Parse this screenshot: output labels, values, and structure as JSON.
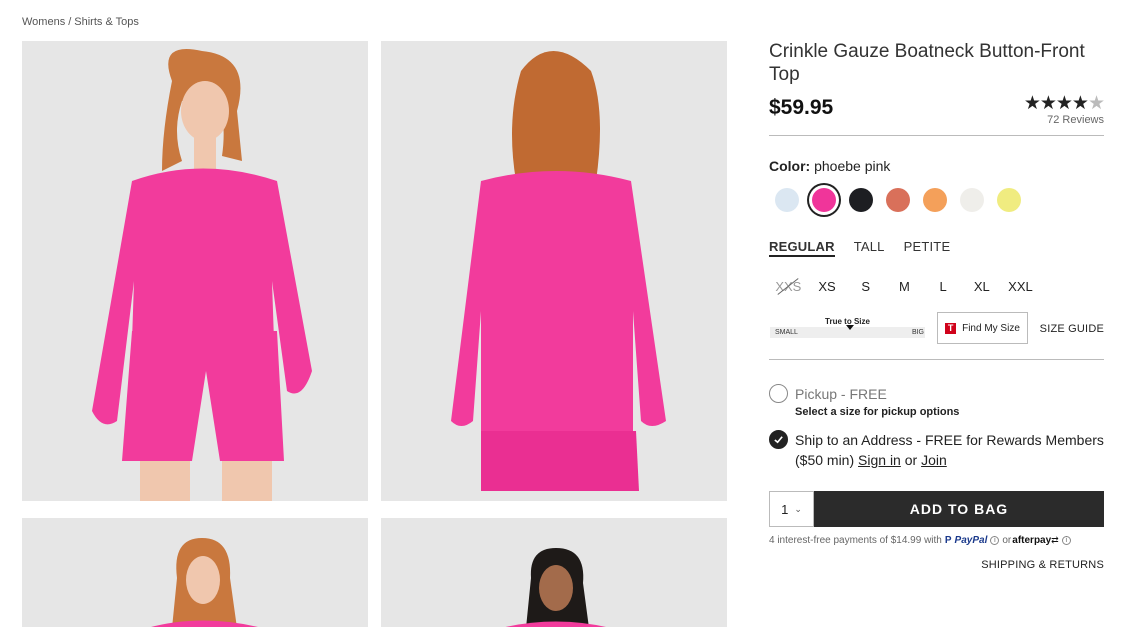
{
  "breadcrumb": [
    "Womens",
    "Shirts & Tops"
  ],
  "breadcrumb_separator": "/",
  "product": {
    "title": "Crinkle Gauze Boatneck Button-Front Top",
    "price": "$59.95",
    "rating": {
      "stars": 4.5,
      "max": 5,
      "reviews_label": "72 Reviews"
    }
  },
  "color": {
    "label": "Color:",
    "value": "phoebe pink",
    "swatches": [
      {
        "name": "light blue",
        "hex": "#dbe7f2"
      },
      {
        "name": "phoebe pink",
        "hex": "#f0359a",
        "selected": true
      },
      {
        "name": "black",
        "hex": "#1d1e22"
      },
      {
        "name": "terracotta",
        "hex": "#d9705a"
      },
      {
        "name": "orange",
        "hex": "#f4a05a"
      },
      {
        "name": "off white",
        "hex": "#efeeea"
      },
      {
        "name": "yellow",
        "hex": "#f0ec80"
      }
    ]
  },
  "fits": [
    {
      "label": "REGULAR",
      "active": true
    },
    {
      "label": "TALL"
    },
    {
      "label": "PETITE"
    }
  ],
  "sizes": [
    {
      "label": "XXS",
      "available": false
    },
    {
      "label": "XS"
    },
    {
      "label": "S"
    },
    {
      "label": "M"
    },
    {
      "label": "L"
    },
    {
      "label": "XL"
    },
    {
      "label": "XXL"
    }
  ],
  "fit_meter": {
    "title": "True to Size",
    "min_label": "SMALL",
    "max_label": "BIG"
  },
  "find_my_size": {
    "logo": "T",
    "label": "Find My Size"
  },
  "size_guide": "SIZE GUIDE",
  "shipping_options": {
    "pickup": {
      "label": "Pickup - FREE",
      "note": "Select a size for pickup options"
    },
    "ship": {
      "label_prefix": "Ship to an Address - FREE for Rewards Members ($50 min)",
      "sign_in": "Sign in",
      "or": "or",
      "join": "Join"
    }
  },
  "quantity": "1",
  "add_to_bag": "ADD TO BAG",
  "payments": {
    "text": "4 interest-free payments of $14.99 with",
    "paypal": "PayPal",
    "or": "or",
    "afterpay": "afterpay"
  },
  "shipping_returns": "SHIPPING & RETURNS",
  "colors": {
    "accent_button": "#2b2b2b",
    "product_pink": "#f0359a"
  }
}
